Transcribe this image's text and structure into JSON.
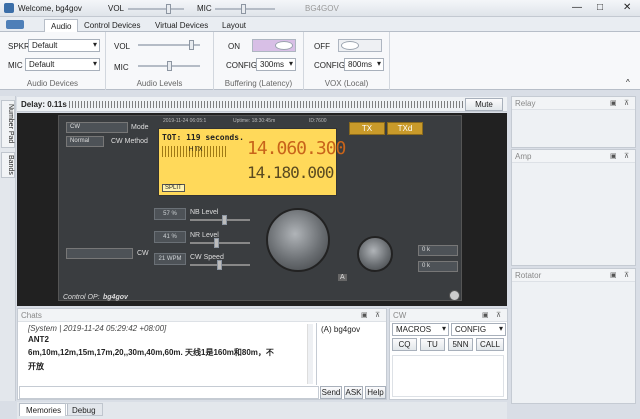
{
  "titlebar": {
    "welcome": "Welcome, bg4gov",
    "vol_label": "VOL",
    "mic_label": "MIC",
    "callsign": "BG4GOV",
    "vol_level": 0.7,
    "mic_level": 0.45
  },
  "ribbon_tabs": [
    "Audio",
    "Control Devices",
    "Virtual Devices",
    "Layout"
  ],
  "audio_devices": {
    "title": "Audio Devices",
    "spkr_label": "SPKR",
    "spkr_value": "Default",
    "mic_label": "MIC",
    "mic_value": "Default"
  },
  "audio_levels": {
    "title": "Audio Levels",
    "vol_label": "VOL",
    "mic_label": "MIC",
    "vol_level": 0.85,
    "mic_level": 0.5
  },
  "buffering": {
    "title": "Buffering (Latency)",
    "state": "ON",
    "config_label": "CONFIG",
    "config_value": "300ms"
  },
  "vox": {
    "title": "VOX (Local)",
    "state": "OFF",
    "config_label": "CONFIG",
    "config_value": "800ms"
  },
  "side_tabs": [
    "Number Pad",
    "Bands"
  ],
  "delay": {
    "label": "Delay: 0.11s",
    "mute": "Mute"
  },
  "radio": {
    "mode": "CW",
    "mode_label": "Mode",
    "method": "Normal",
    "method_label": "CW Method",
    "tx": "TX",
    "txd": "TXd",
    "lcd_date": "2019-11-24 06:05:1",
    "lcd_uptime": "Uptime: 18:30:45m",
    "lcd_id": "ID:7600",
    "tot": "TOT: 119 seconds.",
    "freq_main": "14.060.300",
    "freq_sub": "14.180.000",
    "split": "SPLIT",
    "htx": "H TX",
    "cw_label": "CW",
    "nb_pct": "57 %",
    "nb_label": "NB Level",
    "nr_pct": "41 %",
    "nr_label": "NR Level",
    "wpm": "21 WPM",
    "cw_speed_label": "CW Speed",
    "mini_a": "0 k",
    "mini_b": "0 k",
    "control_op": "Control OP:",
    "control_op_name": "bg4gov",
    "a_label": "A"
  },
  "panes": {
    "relay": "Relay",
    "amp": "Amp",
    "rotator": "Rotator"
  },
  "chats": {
    "title": "Chats",
    "line1": "[System | 2019-11-24 05:29:42 +08:00]",
    "line2": "ANT2",
    "line3": "6m,10m,12m,15m,17m,20,,30m,40m,60m. 天线1是160m和80m，不",
    "line4": "开放",
    "user": "(A) bg4gov",
    "send": "Send",
    "ask": "ASK",
    "help": "Help"
  },
  "cw_panel": {
    "title": "CW",
    "macros": "MACROS",
    "config": "CONFIG",
    "buttons": [
      "CQ",
      "TU",
      "5NN",
      "CALL"
    ]
  },
  "bottom_tabs": [
    "Memories",
    "Debug"
  ]
}
